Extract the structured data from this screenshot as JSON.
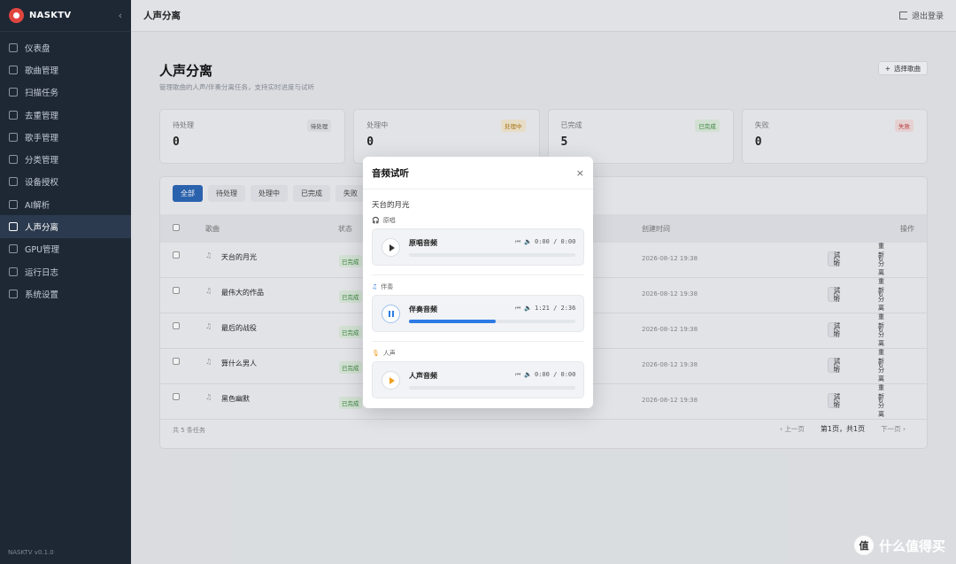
{
  "app": {
    "name": "NASKTV",
    "version": "NASKTV v0.1.0",
    "collapse_icon": "‹"
  },
  "sidebar": {
    "items": [
      {
        "label": "仪表盘"
      },
      {
        "label": "歌曲管理"
      },
      {
        "label": "扫描任务"
      },
      {
        "label": "去重管理"
      },
      {
        "label": "歌手管理"
      },
      {
        "label": "分类管理"
      },
      {
        "label": "设备授权"
      },
      {
        "label": "AI解析"
      },
      {
        "label": "人声分离",
        "active": true
      },
      {
        "label": "GPU管理"
      },
      {
        "label": "运行日志"
      },
      {
        "label": "系统设置"
      }
    ]
  },
  "topbar": {
    "title": "人声分离",
    "logout": "退出登录"
  },
  "page": {
    "title": "人声分离",
    "desc": "管理歌曲的人声/伴奏分离任务，支持实时进度与试听",
    "select_button": "选择歌曲"
  },
  "stats": [
    {
      "label": "待处理",
      "value": "0",
      "badge": "待处理"
    },
    {
      "label": "处理中",
      "value": "0",
      "badge": "处理中"
    },
    {
      "label": "已完成",
      "value": "5",
      "badge": "已完成"
    },
    {
      "label": "失败",
      "value": "0",
      "badge": "失败"
    }
  ],
  "filters": [
    "全部",
    "待处理",
    "处理中",
    "已完成",
    "失败"
  ],
  "table": {
    "headers": {
      "song": "歌曲",
      "status": "状态",
      "created": "创建时间",
      "actions": "操作"
    },
    "status_label": "已完成",
    "listen_label": "试听",
    "reseparate_label": "重新分离",
    "rows": [
      {
        "song": "天台的月光",
        "created": "2026-08-12 19:38"
      },
      {
        "song": "最伟大的作品",
        "created": "2026-08-12 19:38"
      },
      {
        "song": "最后的战役",
        "created": "2026-08-12 19:38"
      },
      {
        "song": "算什么男人",
        "created": "2026-08-12 19:38"
      },
      {
        "song": "黑色幽默",
        "created": "2026-08-12 19:38"
      }
    ],
    "footer": {
      "total": "共 5 条任务",
      "prev": "上一页",
      "page_info": "第1页，共1页",
      "next": "下一页"
    }
  },
  "modal": {
    "title": "音频试听",
    "close": "×",
    "song": "天台的月光",
    "tracks": [
      {
        "label": "原唱",
        "title": "原唱音频",
        "time": "0:00 / 0:00",
        "progress": 0,
        "state": "stopped",
        "icon_color": "#888888"
      },
      {
        "label": "伴奏",
        "title": "伴奏音频",
        "time": "1:21 / 2:36",
        "progress": 0.52,
        "state": "playing",
        "icon_color": "#2c7be5"
      },
      {
        "label": "人声",
        "title": "人声音频",
        "time": "0:00 / 0:00",
        "progress": 0,
        "state": "stopped",
        "icon_color": "#f0a020"
      }
    ]
  },
  "watermark": {
    "text": "什么值得买",
    "logo": "值"
  }
}
